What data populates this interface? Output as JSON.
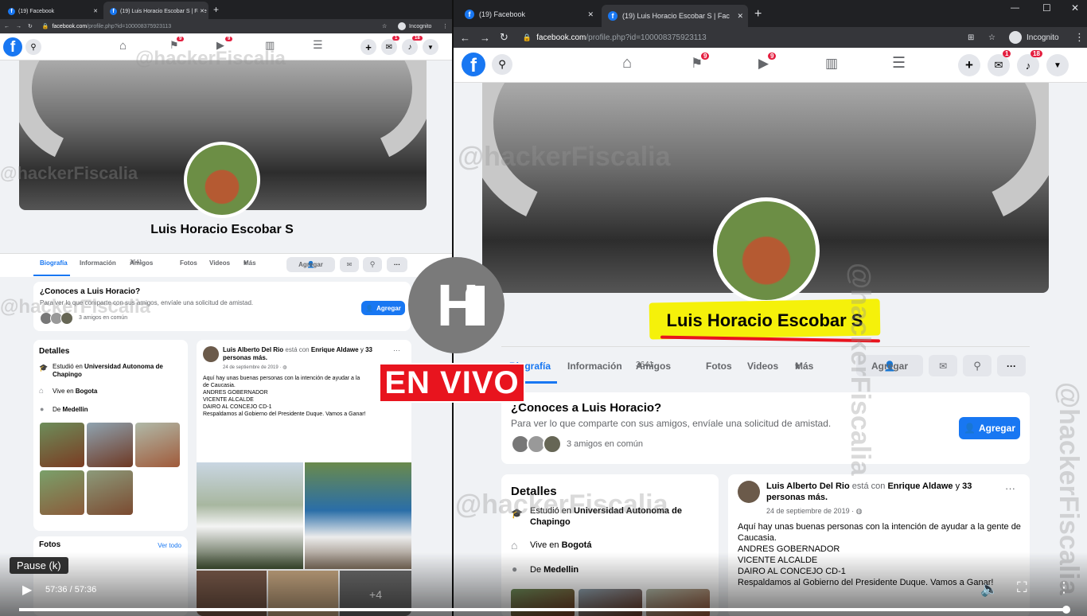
{
  "browser": {
    "tab1_title": "(19) Facebook",
    "tab2_title": "(19) Luis Horacio Escobar S | Face",
    "tab2_title_short": "(19) Luis Horacio Escobar S | Fac",
    "new_tab": "+",
    "url_host": "facebook.com",
    "url_path": "/profile.php?id=100008375923113",
    "incognito_label": "Incognito"
  },
  "fb_header": {
    "logo": "f",
    "flag_badge": "9",
    "video_badge": "9",
    "messenger_badge": "1",
    "notif_badge": "18"
  },
  "profile": {
    "name": "Luis Horacio Escobar S",
    "tabs": [
      "Biografía",
      "Información",
      "Amigos",
      "Fotos",
      "Videos",
      "Más"
    ],
    "friends_count": "3641",
    "add_button": "Agregar",
    "more": "···"
  },
  "know_card": {
    "title": "¿Conoces a Luis Horacio?",
    "text": "Para ver lo que comparte con sus amigos, envíale una solicitud de amistad.",
    "mutual": "3 amigos en común",
    "button": "Agregar"
  },
  "details": {
    "title": "Detalles",
    "study_prefix": "Estudió en",
    "study_place": "Universidad Autonoma de Chapingo",
    "lives_prefix": "Vive en",
    "lives_place": "Bogota",
    "lives_place_right": "Bogotá",
    "from_prefix": "De",
    "from_place": "Medellin",
    "photos_title": "Fotos",
    "see_all": "Ver todo"
  },
  "post": {
    "author": "Luis Alberto Del Rio",
    "with_text": "está con",
    "tagged": "Enrique Aldawe",
    "and_more": "y",
    "others": "33 personas más.",
    "date": "24 de septiembre de 2019 · ",
    "line1": "Aquí hay unas buenas personas con la intención de ayudar a la gente de Caucasia.",
    "line1_left": "Aquí hay unas buenas personas con la intención de ayudar a la",
    "line1_left_b": "de Caucasia.",
    "line2": "ANDRES GOBERNADOR",
    "line3": "VICENTE ALCALDE",
    "line4": "DAIRO AL CONCEJO CD-1",
    "line5": "Respaldamos al Gobierno del Presidente Duque. Vamos a Ganar!",
    "photo_more": "+4"
  },
  "overlay": {
    "logo_text": "H",
    "live_label": "EN VIVO",
    "watermark": "@hackerFiscalia"
  },
  "player": {
    "tooltip": "Pause (k)",
    "time": "57:36 / 57:36",
    "progress": 1.0
  },
  "colors": {
    "fb_blue": "#1877f2",
    "chrome_dark": "#202124",
    "highlight": "#f5f10a",
    "live_red": "#e8141e"
  }
}
